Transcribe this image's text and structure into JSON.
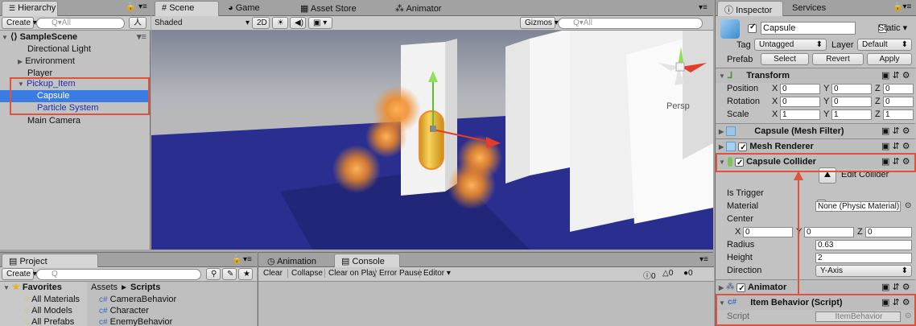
{
  "hierarchy": {
    "tab_label": "Hierarchy",
    "create_label": "Create",
    "search_placeholder": "Q▾All",
    "scene_name": "SampleScene",
    "items": [
      "Directional Light",
      "Environment",
      "Player",
      "Pickup_Item",
      "Capsule",
      "Particle System",
      "Main Camera"
    ]
  },
  "scene_view": {
    "tabs": [
      "Scene",
      "Game",
      "Asset Store",
      "Animator"
    ],
    "shading_mode": "Shaded",
    "mode_2d": "2D",
    "gizmos_label": "Gizmos",
    "search_placeholder": "Q▾All",
    "persp_label": "Persp"
  },
  "project": {
    "tab_label": "Project",
    "create_label": "Create",
    "search_placeholder": "Q",
    "favorites_label": "Favorites",
    "favorites": [
      "All Materials",
      "All Models",
      "All Prefabs"
    ],
    "breadcrumb_root": "Assets",
    "breadcrumb_sep": "►",
    "breadcrumb_current": "Scripts",
    "scripts": [
      "CameraBehavior",
      "Character",
      "EnemyBehavior"
    ]
  },
  "console": {
    "tabs": [
      "Animation",
      "Console"
    ],
    "buttons": [
      "Clear",
      "Collapse",
      "Clear on Play",
      "Error Pause",
      "Editor"
    ],
    "info_count": "0",
    "warn_count": "0",
    "error_count": "0"
  },
  "inspector": {
    "tabs": [
      "Inspector",
      "Services"
    ],
    "object_name": "Capsule",
    "static_label": "Static",
    "tag_label": "Tag",
    "tag_value": "Untagged",
    "layer_label": "Layer",
    "layer_value": "Default",
    "prefab_label": "Prefab",
    "prefab_buttons": [
      "Select",
      "Revert",
      "Apply"
    ],
    "transform": {
      "title": "Transform",
      "rows": [
        {
          "label": "Position",
          "x": "0",
          "y": "0",
          "z": "0"
        },
        {
          "label": "Rotation",
          "x": "0",
          "y": "0",
          "z": "0"
        },
        {
          "label": "Scale",
          "x": "1",
          "y": "1",
          "z": "1"
        }
      ]
    },
    "mesh_filter_title": "Capsule (Mesh Filter)",
    "mesh_renderer_title": "Mesh Renderer",
    "capsule_collider": {
      "title": "Capsule Collider",
      "edit_label": "Edit Collider",
      "is_trigger_label": "Is Trigger",
      "material_label": "Material",
      "material_value": "None (Physic Material)",
      "center_label": "Center",
      "center": {
        "x": "0",
        "y": "0",
        "z": "0"
      },
      "radius_label": "Radius",
      "radius_value": "0.63",
      "height_label": "Height",
      "height_value": "2",
      "direction_label": "Direction",
      "direction_value": "Y-Axis"
    },
    "animator_title": "Animator",
    "item_behavior": {
      "title": "Item Behavior (Script)",
      "script_label": "Script",
      "script_value": "ItemBehavior"
    }
  },
  "axis_labels": {
    "x": "X",
    "y": "Y",
    "z": "Z"
  },
  "colors": {
    "selection": "#3b7ce3",
    "highlight": "#e0533a",
    "floor": "#2a2f8f"
  }
}
